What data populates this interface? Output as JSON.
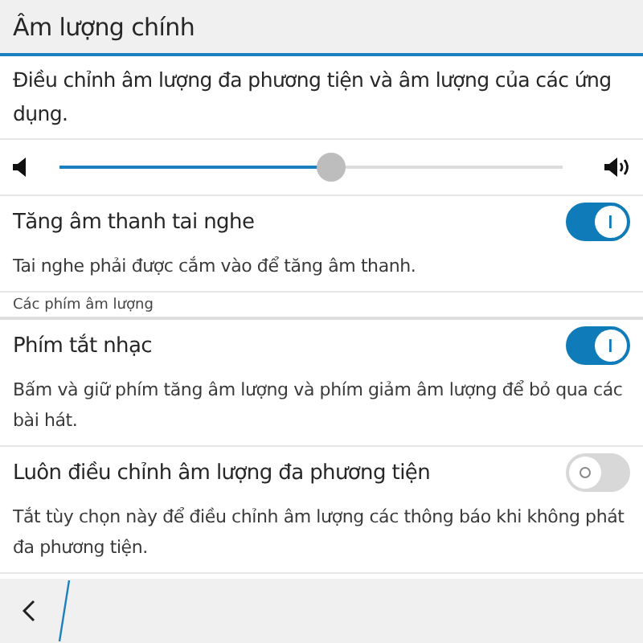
{
  "header": {
    "title": "Âm lượng chính"
  },
  "description": "Điều chỉnh âm lượng đa phương tiện và âm lượng của các ứng dụng.",
  "volume_slider": {
    "level": 0.54
  },
  "settings": [
    {
      "kind": "toggle",
      "label": "Tăng âm thanh tai nghe",
      "on": true,
      "note": "Tai nghe phải được cắm vào để tăng âm thanh."
    },
    {
      "kind": "section",
      "label": "Các phím âm lượng"
    },
    {
      "kind": "toggle",
      "label": "Phím tắt nhạc",
      "on": true,
      "note": "Bấm và giữ phím tăng âm lượng và phím giảm âm lượng để bỏ qua các bài hát."
    },
    {
      "kind": "toggle",
      "label": "Luôn điều chỉnh âm lượng đa phương tiện",
      "on": false,
      "note": "Tắt tùy chọn này để điều chỉnh âm lượng các thông báo khi không phát đa phương tiện."
    }
  ]
}
